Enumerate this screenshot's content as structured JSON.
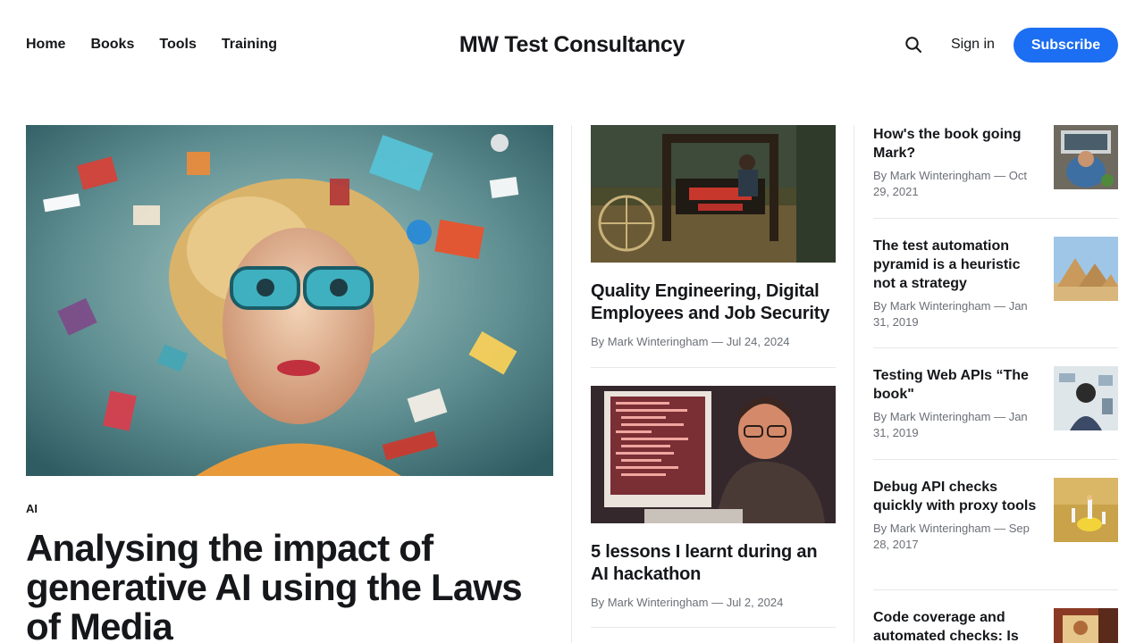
{
  "nav": {
    "items": [
      "Home",
      "Books",
      "Tools",
      "Training"
    ]
  },
  "brand": "MW Test Consultancy",
  "header": {
    "search_icon": "search-icon",
    "signin_label": "Sign in",
    "subscribe_label": "Subscribe"
  },
  "colors": {
    "accent": "#1c6ef2",
    "text": "#15171a",
    "meta": "#6b6f76",
    "divider": "#e6e8eb"
  },
  "hero": {
    "tag": "AI",
    "title": "Analysing the impact of generative AI using the Laws of Media"
  },
  "middle": [
    {
      "title": "Quality Engineering, Digital Employees and Job Security",
      "meta": "By Mark Winteringham — Jul 24, 2024"
    },
    {
      "title": "5 lessons I learnt during an AI hackathon",
      "meta": "By Mark Winteringham — Jul 2, 2024"
    }
  ],
  "sidebar": [
    {
      "title": "How's the book going Mark?",
      "meta": "By Mark Winteringham — Oct 29, 2021"
    },
    {
      "title": "The test automation pyramid is a heuristic not a strategy",
      "meta": "By Mark Winteringham — Jan 31, 2019"
    },
    {
      "title": "Testing Web APIs “The book\"",
      "meta": "By Mark Winteringham — Jan 31, 2019"
    },
    {
      "title": "Debug API checks quickly with proxy tools",
      "meta": "By Mark Winteringham — Sep 28, 2017"
    },
    {
      "title": "Code coverage and automated checks: Is",
      "meta": ""
    }
  ]
}
